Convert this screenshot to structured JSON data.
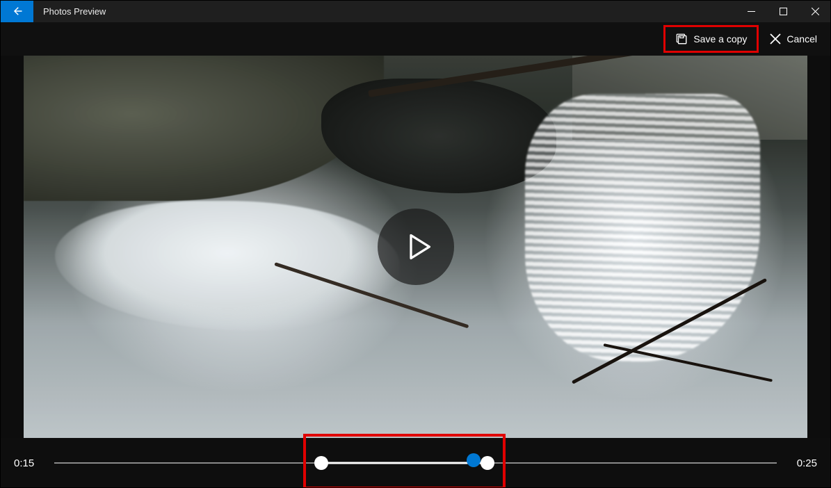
{
  "titlebar": {
    "app_title": "Photos Preview"
  },
  "toolbar": {
    "save_label": "Save a copy",
    "cancel_label": "Cancel"
  },
  "trim": {
    "start_time": "0:15",
    "end_time": "0:25",
    "range_start_pct": 37,
    "range_end_pct": 60,
    "playhead_pct": 58
  },
  "highlights": {
    "save_button": true,
    "trim_handles": true
  }
}
